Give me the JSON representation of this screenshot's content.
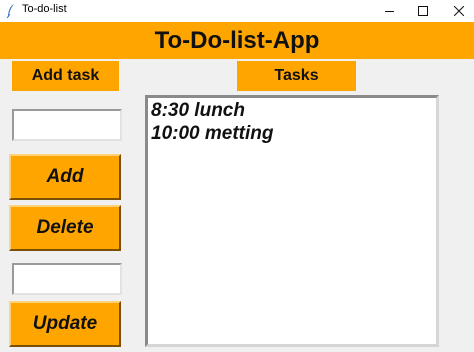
{
  "window": {
    "title": "To-do-list",
    "minimize_glyph": "—",
    "maximize_glyph": "☐",
    "close_glyph": "✕",
    "icon": "feather-icon"
  },
  "header": {
    "title": "To-Do-list-App"
  },
  "left_panel": {
    "add_task_label": "Add task",
    "task_entry_value": "",
    "update_entry_value": "",
    "add_button": "Add",
    "delete_button": "Delete",
    "update_button": "Update"
  },
  "tasks_panel": {
    "label": "Tasks",
    "items": [
      "8:30 lunch",
      "10:00 metting"
    ]
  },
  "colors": {
    "accent": "#ffa500",
    "background": "#f0f0f0",
    "list_background": "#ffffff"
  }
}
